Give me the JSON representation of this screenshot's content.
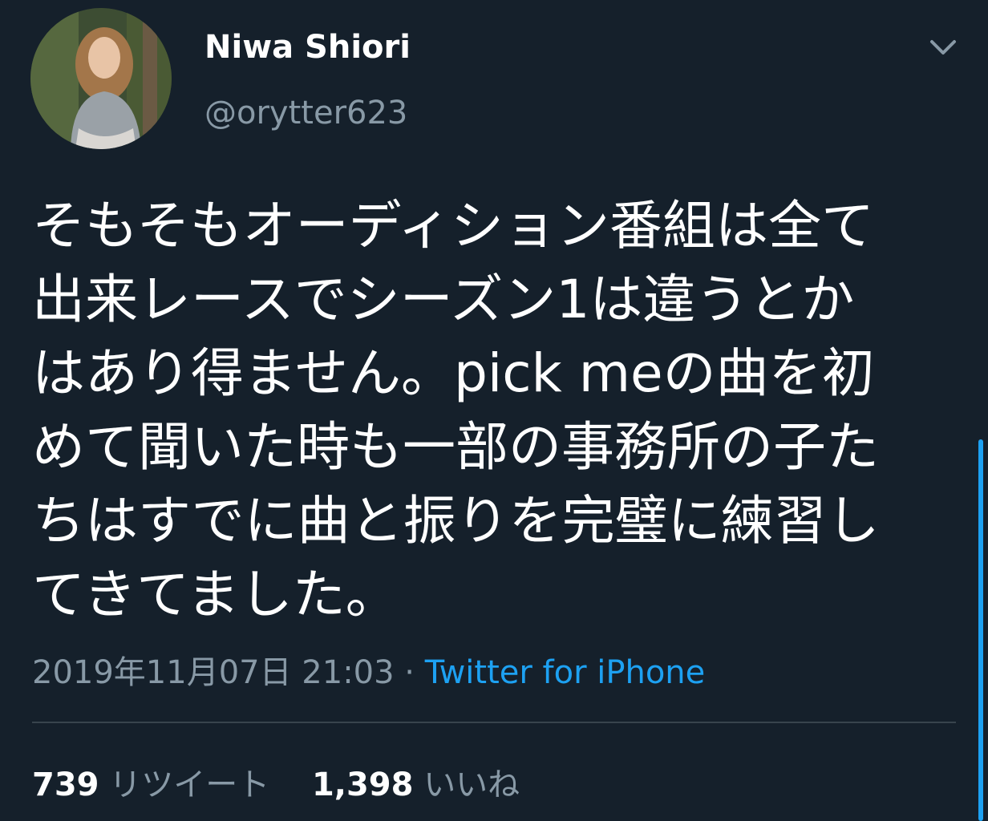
{
  "user": {
    "display_name": "Niwa Shiori",
    "handle": "@orytter623",
    "avatar_icon": "profile-photo"
  },
  "tweet": {
    "lines": [
      "そもそもオーディション番組は全て",
      "出来レースでシーズン1は違うとか",
      "はあり得ません。pick meの曲を初",
      "めて聞いた時も一部の事務所の子た",
      "ちはすでに曲と振りを完璧に練習し",
      "てきてました。"
    ],
    "timestamp": "2019年11月07日 21:03",
    "separator": " · ",
    "source": "Twitter for iPhone"
  },
  "stats": {
    "retweets_count": "739",
    "retweets_label": "リツイート",
    "likes_count": "1,398",
    "likes_label": "いいね"
  },
  "colors": {
    "background": "#15202b",
    "secondary_text": "#8899a6",
    "accent": "#1da1f2",
    "divider": "#38444d"
  }
}
